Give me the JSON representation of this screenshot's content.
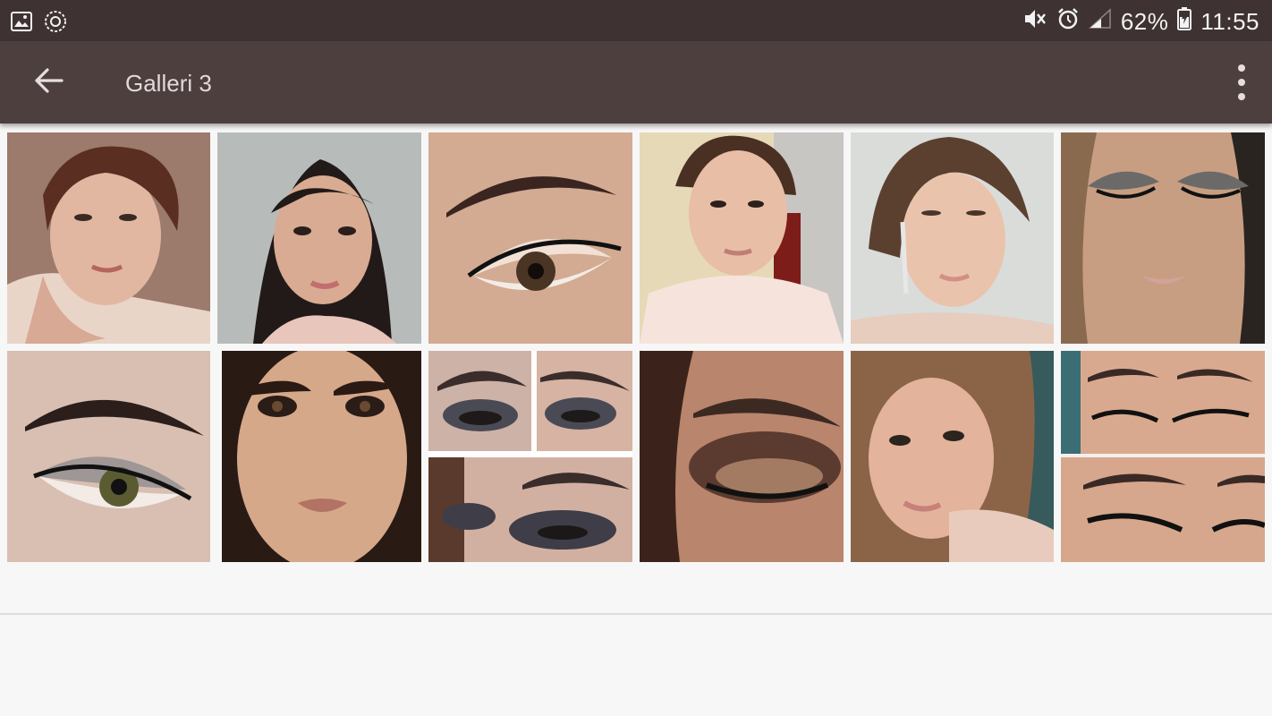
{
  "status_bar": {
    "battery": "62%",
    "time": "11:55",
    "icons": [
      "image-icon",
      "sync-icon",
      "mute-icon",
      "alarm-icon",
      "signal-icon",
      "battery-icon"
    ]
  },
  "app_bar": {
    "title": "Galleri 3",
    "back_icon": "arrow-left-icon",
    "menu_icon": "more-vert-icon"
  },
  "gallery": {
    "items": [
      {
        "label": "portrait-1"
      },
      {
        "label": "portrait-2"
      },
      {
        "label": "eye-closeup-1"
      },
      {
        "label": "portrait-3"
      },
      {
        "label": "portrait-4"
      },
      {
        "label": "closed-eyes-1"
      },
      {
        "label": "eye-closeup-2"
      },
      {
        "label": "portrait-5"
      },
      {
        "label": "smoky-eyes-collage"
      },
      {
        "label": "eye-closeup-3"
      },
      {
        "label": "portrait-6"
      },
      {
        "label": "eyes-collage-2"
      }
    ]
  },
  "colors": {
    "status_bar": "#3f3232",
    "app_bar": "#4e3f3f",
    "background": "#f7f7f7"
  }
}
